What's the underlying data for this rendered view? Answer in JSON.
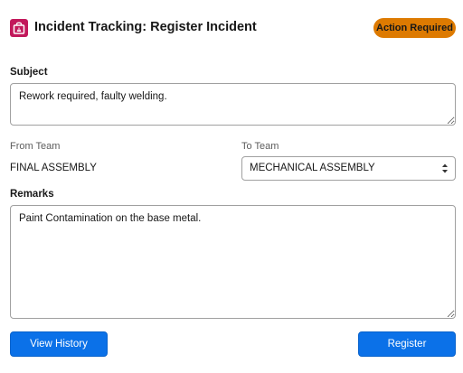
{
  "header": {
    "title": "Incident Tracking: Register Incident",
    "badge": "Action Required",
    "icon": "incident-bag-icon",
    "accent_color": "#c2185b",
    "badge_color": "#dd7a01"
  },
  "form": {
    "subject_label": "Subject",
    "subject_value": "Rework required, faulty welding.",
    "from_team_label": "From Team",
    "from_team_value": "FINAL ASSEMBLY",
    "to_team_label": "To Team",
    "to_team_value": "MECHANICAL ASSEMBLY",
    "remarks_label": "Remarks",
    "remarks_value": "Paint Contamination on the base metal."
  },
  "actions": {
    "view_history_label": "View History",
    "register_label": "Register",
    "button_color": "#0b71e8"
  }
}
